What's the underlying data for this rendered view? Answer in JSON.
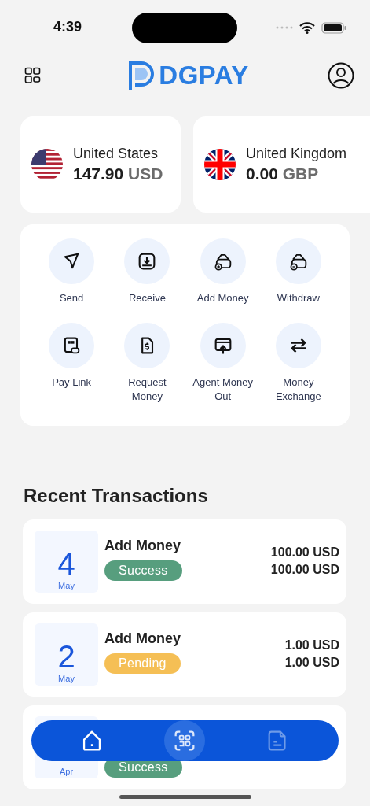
{
  "status_bar": {
    "time": "4:39"
  },
  "header": {
    "logo_text": "DGPAY"
  },
  "balances": [
    {
      "country": "United States",
      "amount": "147.90",
      "currency": "USD"
    },
    {
      "country": "United Kingdom",
      "amount": "0.00",
      "currency": "GBP"
    }
  ],
  "actions": [
    {
      "label": "Send"
    },
    {
      "label": "Receive"
    },
    {
      "label": "Add Money"
    },
    {
      "label": "Withdraw"
    },
    {
      "label": "Pay Link"
    },
    {
      "label": "Request Money"
    },
    {
      "label": "Agent Money Out"
    },
    {
      "label": "Money Exchange"
    }
  ],
  "recent_transactions": {
    "title": "Recent Transactions",
    "items": [
      {
        "day": "4",
        "month": "May",
        "title": "Add Money",
        "status": "Success",
        "color": "#579e7e",
        "amounts": [
          "100.00 USD",
          "100.00 USD"
        ]
      },
      {
        "day": "2",
        "month": "May",
        "title": "Add Money",
        "status": "Pending",
        "color": "#f5bf55",
        "amounts": [
          "1.00 USD",
          "1.00 USD"
        ]
      },
      {
        "month": "Apr",
        "status": "Success",
        "color": "#579e7e"
      }
    ]
  },
  "bottom_nav": [
    {
      "kind": "plain",
      "selected": true
    },
    {
      "kind": "center",
      "selected": false
    },
    {
      "kind": "plain",
      "selected": false
    }
  ]
}
